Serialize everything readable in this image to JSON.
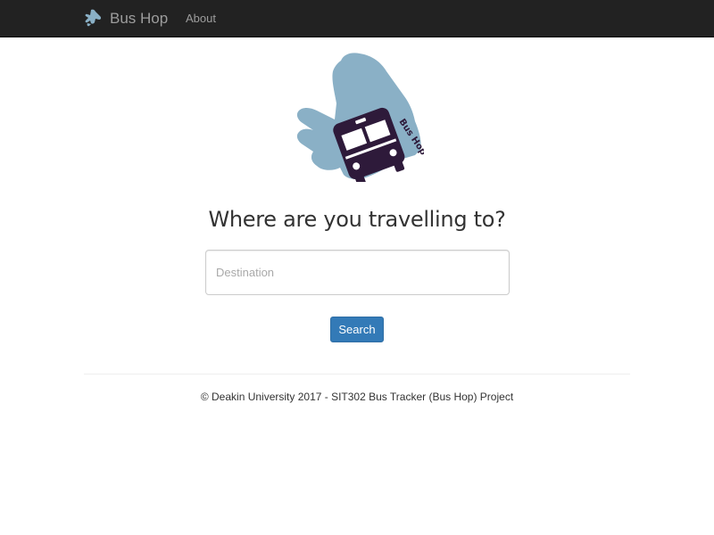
{
  "navbar": {
    "brand_label": "Bus Hop",
    "brand_icon": "hand-icon",
    "links": [
      {
        "label": "About"
      }
    ]
  },
  "hero": {
    "logo_icon": "bus-hop-logo",
    "logo_text": "Bus Hop",
    "heading": "Where are you travelling to?"
  },
  "search": {
    "destination_placeholder": "Destination",
    "destination_value": "",
    "button_label": "Search"
  },
  "footer": {
    "text": "© Deakin University 2017 - SIT302 Bus Tracker (Bus Hop) Project"
  },
  "colors": {
    "navbar_bg": "#222222",
    "hand_blue": "#8ab0c6",
    "bus_purple": "#2e1a3a",
    "primary_button": "#337ab7"
  }
}
